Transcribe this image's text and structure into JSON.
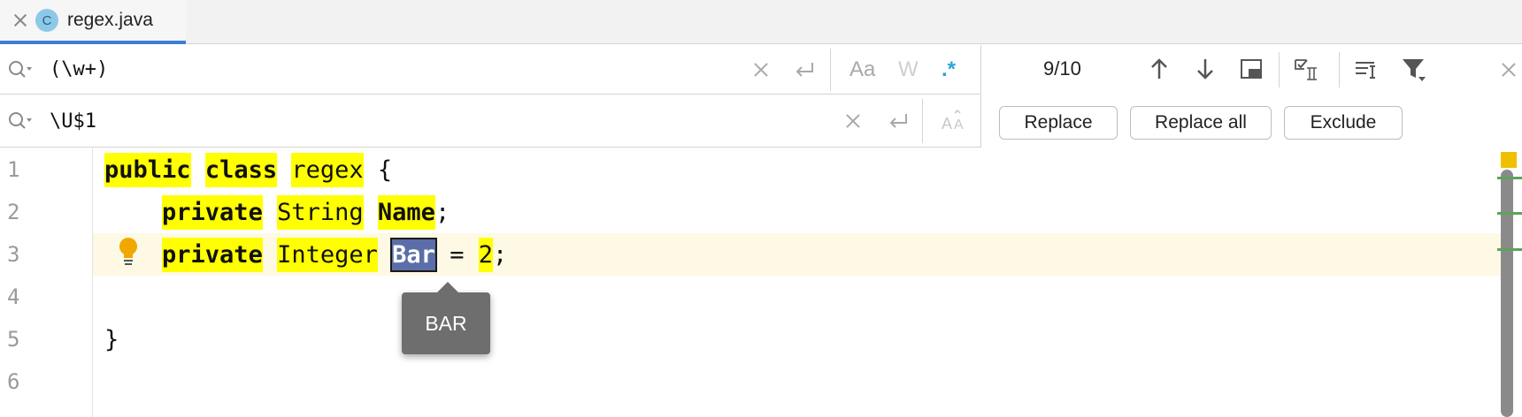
{
  "tab": {
    "label": "regex.java",
    "icon": "class-icon",
    "icon_letter": "C"
  },
  "find": {
    "value": "(\\w+)",
    "options": {
      "match_case": "Aa",
      "words": "W",
      "regex": ".*"
    }
  },
  "replace": {
    "value": "\\U$1"
  },
  "results": {
    "count": "9/10"
  },
  "buttons": {
    "replace": "Replace",
    "replace_all": "Replace all",
    "exclude": "Exclude"
  },
  "editor": {
    "line_numbers": [
      "1",
      "2",
      "3",
      "4",
      "5",
      "6"
    ],
    "lines": {
      "l1": {
        "t1": "public",
        "t2": " ",
        "t3": "class",
        "t4": " ",
        "t5": "regex",
        "t6": " {"
      },
      "l2": {
        "t0": "    ",
        "t1": "private",
        "t2": " ",
        "t3": "String",
        "t4": " ",
        "t5": "Name",
        "t6": ";"
      },
      "l3": {
        "t0": "    ",
        "t1": "private",
        "t2": " ",
        "t3": "Integer",
        "t4": " ",
        "t5": "Bar",
        "t6": " = ",
        "t7": "2",
        "t8": ";"
      },
      "l5": {
        "t1": "}"
      }
    },
    "current_line": 3
  },
  "tooltip": {
    "text": "BAR"
  },
  "colors": {
    "highlight": "#ffff00",
    "selection": "#5b6ea8",
    "accent": "#3d7fd4",
    "regex_active": "#2ba3d9"
  }
}
